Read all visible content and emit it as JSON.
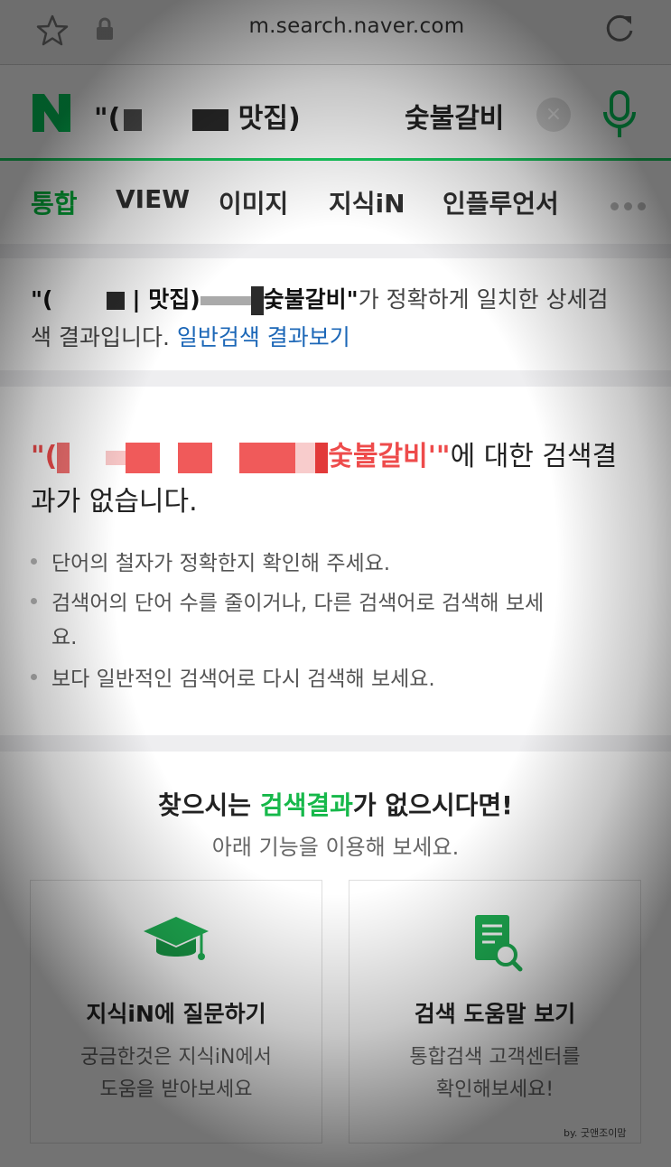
{
  "browser": {
    "url": "m.search.naver.com",
    "icons": [
      "star-icon",
      "lock-icon",
      "reload-icon"
    ]
  },
  "search": {
    "logo": "N",
    "query_part1_open": "\"(",
    "query_part1_end": "맛집)",
    "query_part2": "숯불갈비",
    "clear_label": "×",
    "icons": [
      "naver-logo-icon",
      "clear-icon",
      "mic-icon"
    ]
  },
  "tabs": [
    {
      "label": "통합",
      "active": true
    },
    {
      "label": "VIEW",
      "active": false
    },
    {
      "label": "이미지",
      "active": false
    },
    {
      "label": "지식iN",
      "active": false
    },
    {
      "label": "인플루언서",
      "active": false
    }
  ],
  "notice": {
    "open": "\"(",
    "mid": "| 맛집)",
    "term": "숯불갈비\"",
    "rest1": "가 정확하게 일치한 상세검",
    "rest2": "색 결과입니다.",
    "link": "일반검색 결과보기"
  },
  "no_result": {
    "open": "\"(",
    "term": "숯불갈비'\"",
    "rest1": "에 대한 검색결",
    "rest2": "과가 없습니다.",
    "tips": [
      "단어의 철자가 정확한지 확인해 주세요.",
      "검색어의 단어 수를 줄이거나, 다른 검색어로 검색해 보세",
      "요.",
      "보다 일반적인 검색어로 다시 검색해 보세요."
    ]
  },
  "suggest": {
    "title_a": "찾으시는 ",
    "title_b": "검색결과",
    "title_c": "가 없으시다면!",
    "subtitle": "아래 기능을 이용해 보세요.",
    "cards": [
      {
        "title": "지식iN에 질문하기",
        "desc1": "궁금한것은 지식iN에서",
        "desc2": "도움을 받아보세요",
        "icon": "graduation-cap-icon"
      },
      {
        "title": "검색 도움말 보기",
        "desc1": "통합검색 고객센터를",
        "desc2": "확인해보세요!",
        "icon": "document-search-icon"
      }
    ],
    "credit": "by. 굿앤조이맘"
  },
  "colors": {
    "naver_green": "#03c75a",
    "tab_active": "#03b43c",
    "link_blue": "#1c67b7",
    "highlight_red": "#ee4b4b"
  }
}
